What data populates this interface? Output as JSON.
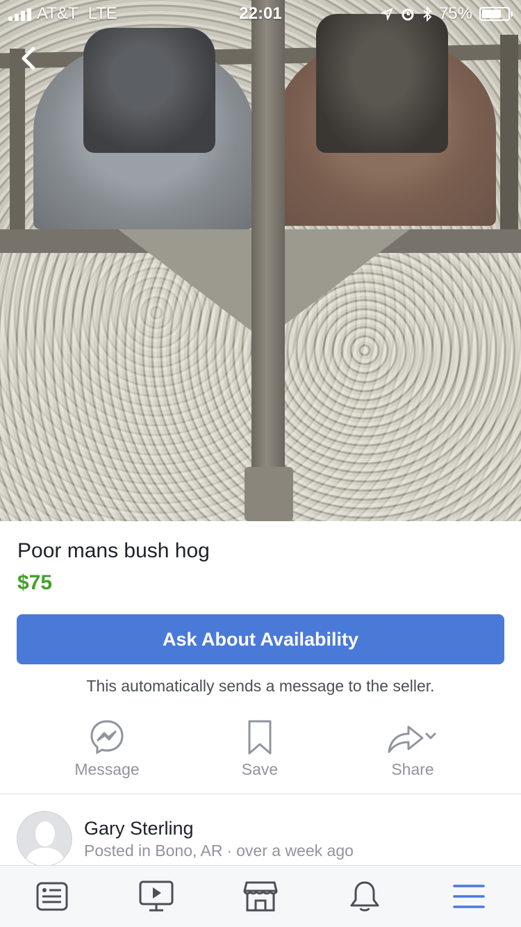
{
  "status_bar": {
    "carrier": "AT&T",
    "network": "LTE",
    "time": "22:01",
    "battery_percent": "75%",
    "battery_level": 0.75,
    "icons": [
      "signal-icon",
      "location-icon",
      "alarm-icon",
      "bluetooth-icon",
      "battery-icon"
    ]
  },
  "nav": {
    "back_icon": "chevron-left-icon"
  },
  "listing": {
    "title": "Poor mans bush hog",
    "price": "$75",
    "primary_action": "Ask About Availability",
    "primary_action_color": "#4a7ad8",
    "price_color": "#42a12b",
    "note": "This automatically sends a message to the seller."
  },
  "actions": [
    {
      "label": "Message",
      "icon": "messenger-icon"
    },
    {
      "label": "Save",
      "icon": "bookmark-icon"
    },
    {
      "label": "Share",
      "icon": "share-icon"
    }
  ],
  "seller": {
    "name": "Gary Sterling",
    "location": "Posted in Bono, AR",
    "separator": "·",
    "posted": "over a week ago"
  },
  "tab_bar": {
    "tabs": [
      {
        "icon": "news-feed-icon"
      },
      {
        "icon": "video-icon"
      },
      {
        "icon": "marketplace-icon"
      },
      {
        "icon": "notifications-icon"
      },
      {
        "icon": "menu-icon",
        "active": true
      }
    ],
    "active_color": "#4a7ad8",
    "inactive_color": "#4b4f56"
  }
}
